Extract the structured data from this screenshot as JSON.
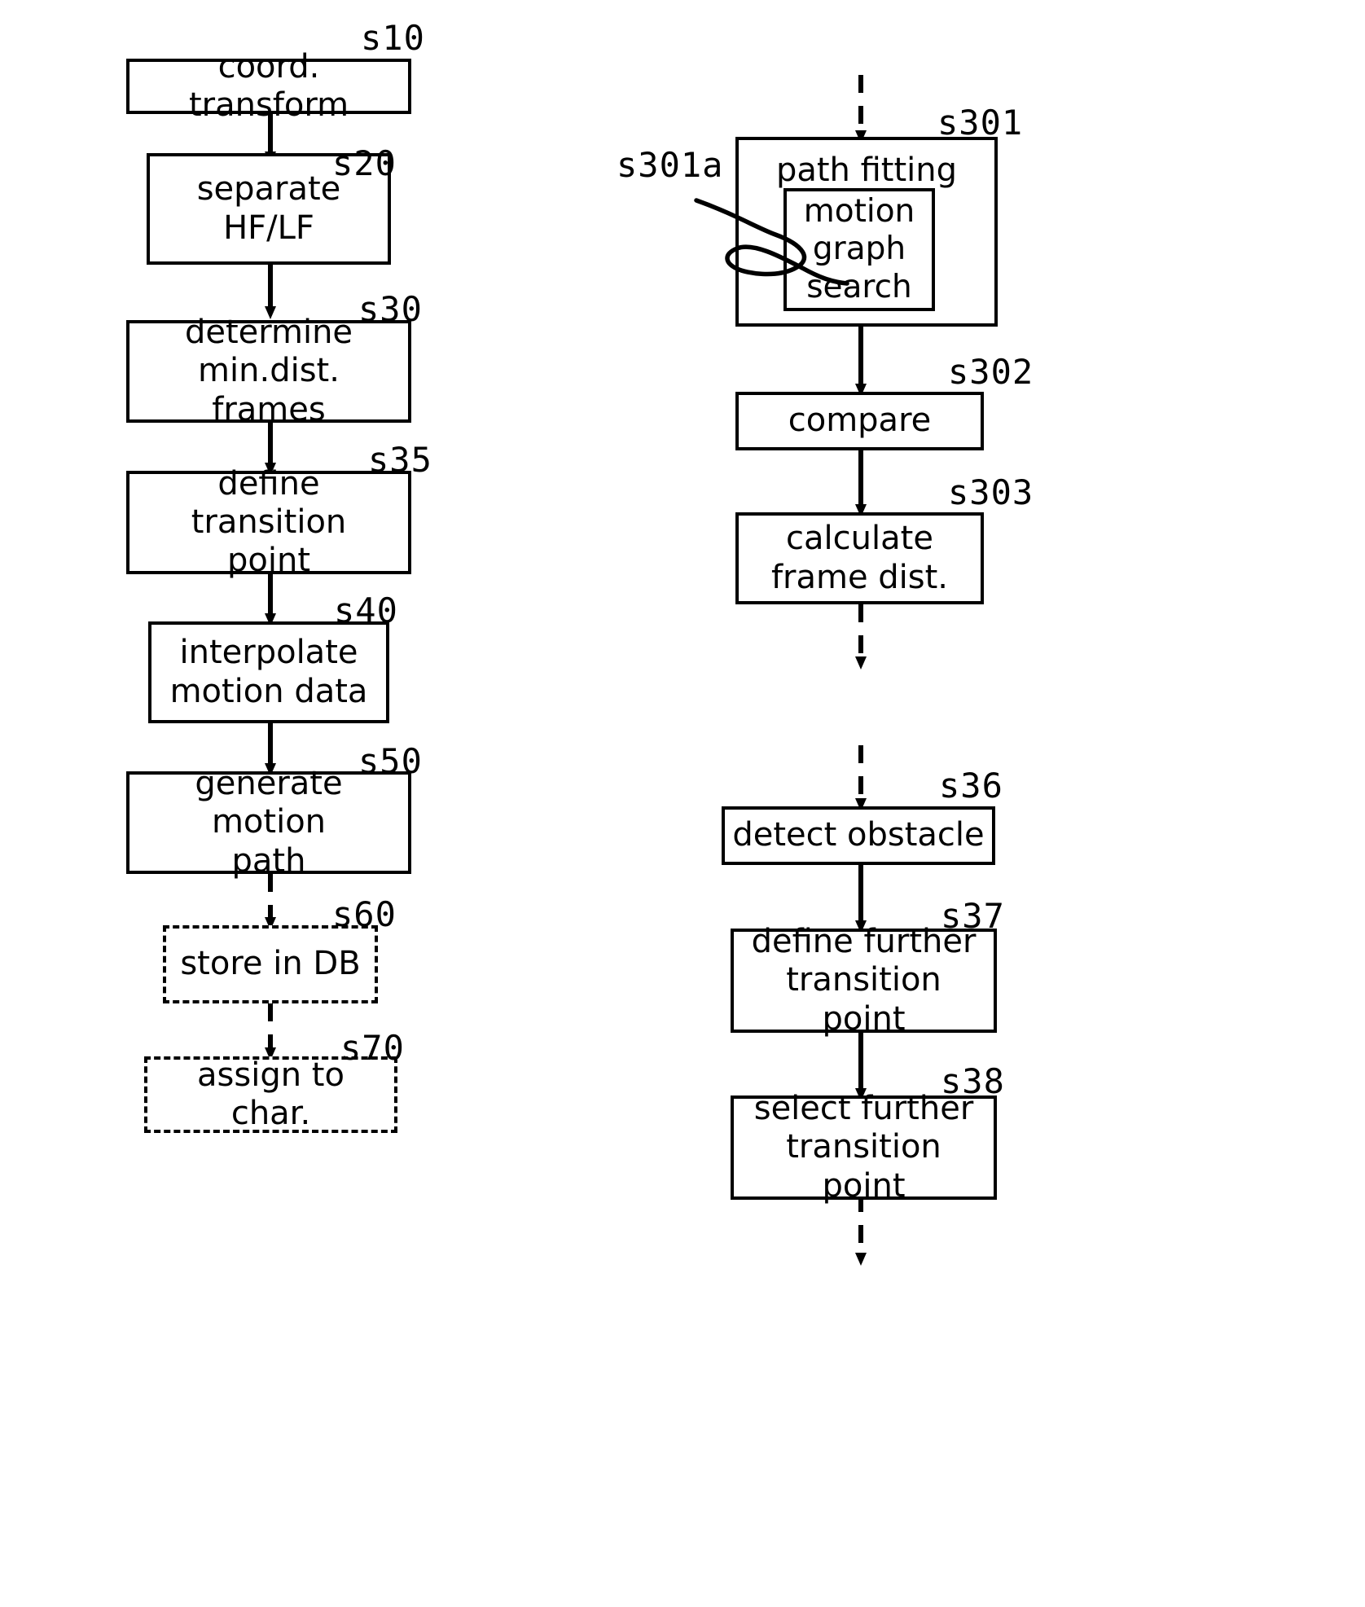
{
  "figure": {
    "kind": "patent-flowchart",
    "background_color": "#ffffff",
    "line_color": "#000000"
  },
  "left_column": {
    "nodes": [
      {
        "id": "s10",
        "tag": "s10",
        "label": "coord. transform",
        "style": "solid"
      },
      {
        "id": "s20",
        "tag": "s20",
        "label": "separate\nHF/LF",
        "style": "solid"
      },
      {
        "id": "s30",
        "tag": "s30",
        "label": "determine\nmin.dist. frames",
        "style": "solid"
      },
      {
        "id": "s35",
        "tag": "s35",
        "label": "define transition\npoint",
        "style": "solid"
      },
      {
        "id": "s40",
        "tag": "s40",
        "label": "interpolate\nmotion data",
        "style": "solid"
      },
      {
        "id": "s50",
        "tag": "s50",
        "label": "generate motion\npath",
        "style": "solid"
      },
      {
        "id": "s60",
        "tag": "s60",
        "label": "store in DB",
        "style": "dashed"
      },
      {
        "id": "s70",
        "tag": "s70",
        "label": "assign to char.",
        "style": "dashed"
      }
    ],
    "connectors": [
      {
        "from": "s10",
        "to": "s20",
        "style": "solid"
      },
      {
        "from": "s20",
        "to": "s30",
        "style": "solid"
      },
      {
        "from": "s30",
        "to": "s35",
        "style": "solid"
      },
      {
        "from": "s35",
        "to": "s40",
        "style": "solid"
      },
      {
        "from": "s40",
        "to": "s50",
        "style": "solid"
      },
      {
        "from": "s50",
        "to": "s60",
        "style": "dashed"
      },
      {
        "from": "s60",
        "to": "s70",
        "style": "dashed"
      }
    ]
  },
  "right_column": {
    "entry_connector": {
      "to": "s301",
      "style": "dashed"
    },
    "nodes": [
      {
        "id": "s301",
        "tag": "s301",
        "label": "path fitting",
        "style": "solid"
      },
      {
        "id": "s301a_box",
        "tag": "s301a",
        "label": "motion\ngraph\nsearch",
        "style": "solid",
        "nested_in": "s301"
      },
      {
        "id": "s302",
        "tag": "s302",
        "label": "compare",
        "style": "solid"
      },
      {
        "id": "s303",
        "tag": "s303",
        "label": "calculate\nframe dist.",
        "style": "solid"
      },
      {
        "id": "s36",
        "tag": "s36",
        "label": "detect obstacle",
        "style": "solid"
      },
      {
        "id": "s37",
        "tag": "s37",
        "label": "define further\ntransition point",
        "style": "solid"
      },
      {
        "id": "s38",
        "tag": "s38",
        "label": "select further\ntransition point",
        "style": "solid"
      }
    ],
    "connectors": [
      {
        "from": "s301",
        "to": "s302",
        "style": "solid"
      },
      {
        "from": "s302",
        "to": "s303",
        "style": "solid"
      },
      {
        "from": "s303",
        "to": "exit",
        "style": "dashed"
      },
      {
        "from": "entry",
        "to": "s36",
        "style": "dashed"
      },
      {
        "from": "s36",
        "to": "s37",
        "style": "solid"
      },
      {
        "from": "s37",
        "to": "s38",
        "style": "solid"
      },
      {
        "from": "s38",
        "to": "exit",
        "style": "dashed"
      }
    ],
    "leader_label": "s301a"
  }
}
